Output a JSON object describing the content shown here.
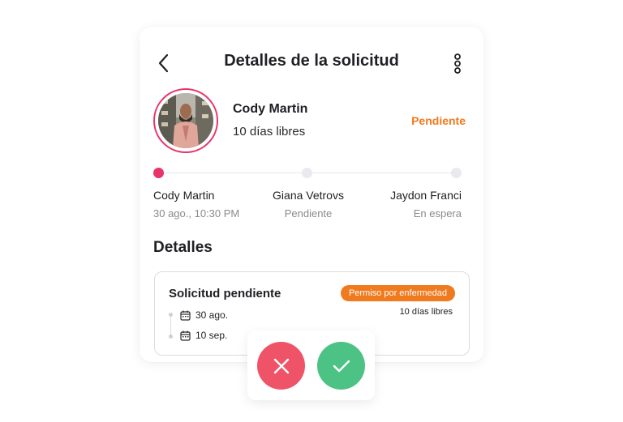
{
  "header": {
    "title": "Detalles de la solicitud"
  },
  "requester": {
    "name": "Cody Martin",
    "days": "10 días libres",
    "status": "Pendiente"
  },
  "approval_steps": [
    {
      "name": "Cody Martin",
      "sub": "30 ago., 10:30 PM",
      "state": "active"
    },
    {
      "name": "Giana Vetrovs",
      "sub": "Pendiente",
      "state": "inactive"
    },
    {
      "name": "Jaydon Franci",
      "sub": "En espera",
      "state": "inactive"
    }
  ],
  "details": {
    "section_title": "Detalles",
    "request_title": "Solicitud pendiente",
    "badge": "Permiso por enfermedad",
    "days": "10 días libres",
    "start_date": "30 ago.",
    "end_date": "10 sep."
  },
  "colors": {
    "accent_pink": "#e8336b",
    "status_orange": "#f07a1e",
    "reject_red": "#ef5367",
    "approve_green": "#4cc385"
  },
  "icons": {
    "back": "chevron-left-icon",
    "more": "vertical-dots-icon",
    "calendar": "calendar-icon",
    "reject": "close-icon",
    "approve": "check-icon"
  }
}
